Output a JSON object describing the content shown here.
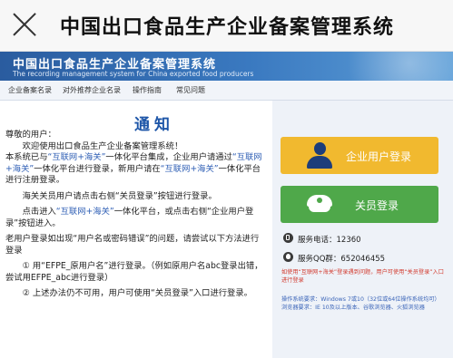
{
  "wechat_header": {
    "title": "中国出口食品生产企业备案管理系统",
    "close_icon": "close-icon"
  },
  "banner": {
    "title": "中国出口食品生产企业备案管理系统",
    "subtitle": "The recording management system for China exported food producers"
  },
  "nav": {
    "items": [
      "企业备案名录",
      "对外推荐企业名录",
      "操作指南",
      "常见问题"
    ]
  },
  "notice": {
    "title": "通知",
    "greeting": "尊敬的用户：",
    "p1": "欢迎使用出口食品生产企业备案管理系统！",
    "p2_a": "本系统已与",
    "p2_hl": "“互联网+海关”",
    "p2_b": "一体化平台集成，企业用户请通过",
    "p2_hl2": "“互联网+海关”",
    "p2_c": "一体化平台进行登录，新用户请在",
    "p2_hl3": "“互联网+海关”",
    "p2_d": "一体化平台进行注册登录。",
    "p3": "海关关员用户请点击右侧“关员登录”按钮进行登录。",
    "p4_a": "点击进入",
    "p4_hl": "“互联网+海关”",
    "p4_b": "一体化平台，或点击右侧“企业用户登录”按钮进入。",
    "p5": "老用户登录如出现“用户名或密码错误”的问题，请尝试以下方法进行登录",
    "p6": "① 用“EFPE_原用户名”进行登录。（例如原用户名abc登录出错，尝试用EFPE_abc进行登录）",
    "p7": "② 上述办法仍不可用，用户可使用“关员登录”入口进行登录。"
  },
  "side": {
    "user_login_label": "企业用户登录",
    "officer_login_label": "关员登录",
    "phone_label": "服务电话：",
    "phone_value": "12360",
    "qq_label": "服务QQ群：",
    "qq_value": "652046455",
    "hint": "如使用“互联网+海关”登录遇到问题，用户可使用“关员登录”入口进行登录",
    "requirements_os": "操作系统要求：Windows 7或10（32位或64位操作系统均可）",
    "requirements_browser": "浏览器要求：IE 10及以上版本、谷歌浏览器、火狐浏览器",
    "colors": {
      "user_button": "#f1b92f",
      "officer_button": "#4fa84a",
      "notice_title": "#1e56a8",
      "hint": "#d23a2e"
    }
  }
}
